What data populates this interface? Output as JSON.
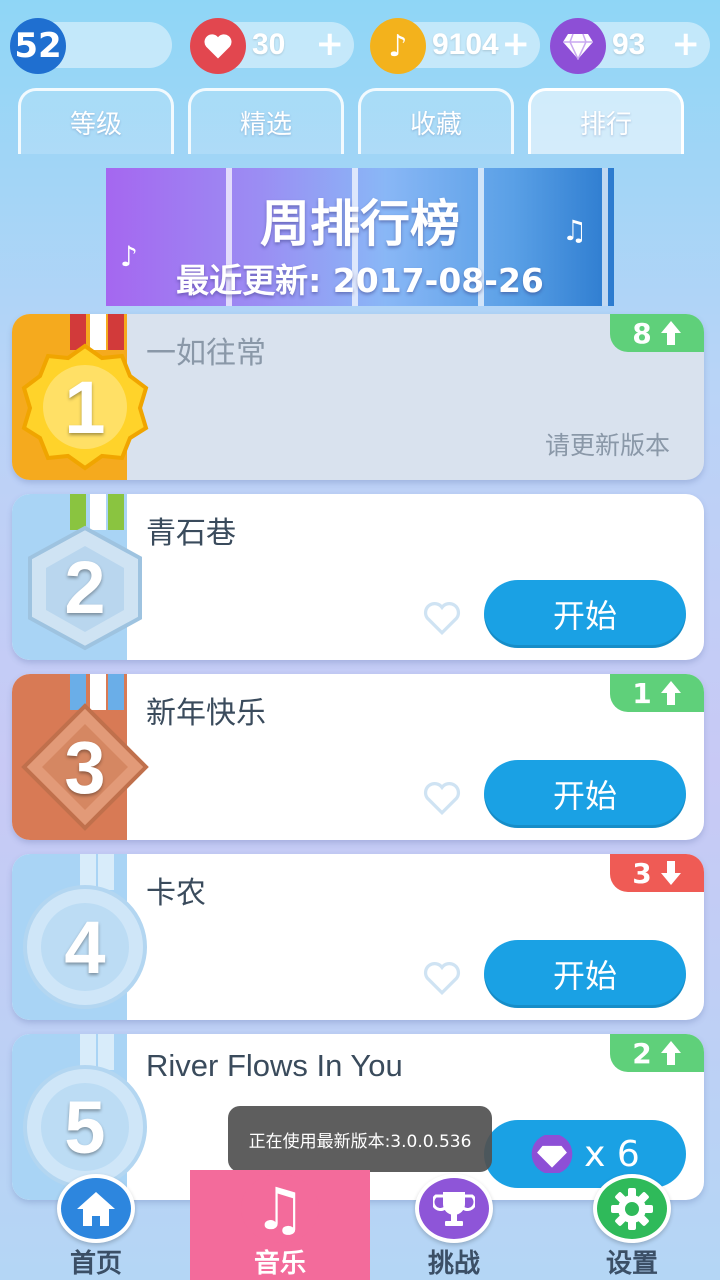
{
  "topbar": {
    "level": "52",
    "hearts": "30",
    "notes": "9104",
    "gems": "93",
    "plus": "+"
  },
  "tabs": [
    {
      "label": "等级",
      "active": false
    },
    {
      "label": "精选",
      "active": false
    },
    {
      "label": "收藏",
      "active": false
    },
    {
      "label": "排行",
      "active": true
    }
  ],
  "banner": {
    "title": "周排行榜",
    "subtitle": "最近更新: 2017-08-26"
  },
  "list": [
    {
      "rank": "1",
      "song": "一如往常",
      "trend": "8",
      "trend_dir": "up",
      "status": "请更新版本"
    },
    {
      "rank": "2",
      "song": "青石巷",
      "start": "开始"
    },
    {
      "rank": "3",
      "song": "新年快乐",
      "trend": "1",
      "trend_dir": "up",
      "start": "开始"
    },
    {
      "rank": "4",
      "song": "卡农",
      "trend": "3",
      "trend_dir": "down",
      "start": "开始"
    },
    {
      "rank": "5",
      "song": "River Flows In You",
      "trend": "2",
      "trend_dir": "up",
      "cost": "x 6"
    }
  ],
  "toast": "正在使用最新版本:3.0.0.536",
  "nav": [
    {
      "label": "首页",
      "icon": "home-icon"
    },
    {
      "label": "音乐",
      "icon": "music-note-icon",
      "active": true
    },
    {
      "label": "挑战",
      "icon": "trophy-icon"
    },
    {
      "label": "设置",
      "icon": "gear-icon"
    }
  ],
  "colors": {
    "start_button": "#1aa1e4",
    "trend_up": "#5fd07a",
    "trend_down": "#ef5b55",
    "nav_active": "#f36b9b"
  }
}
